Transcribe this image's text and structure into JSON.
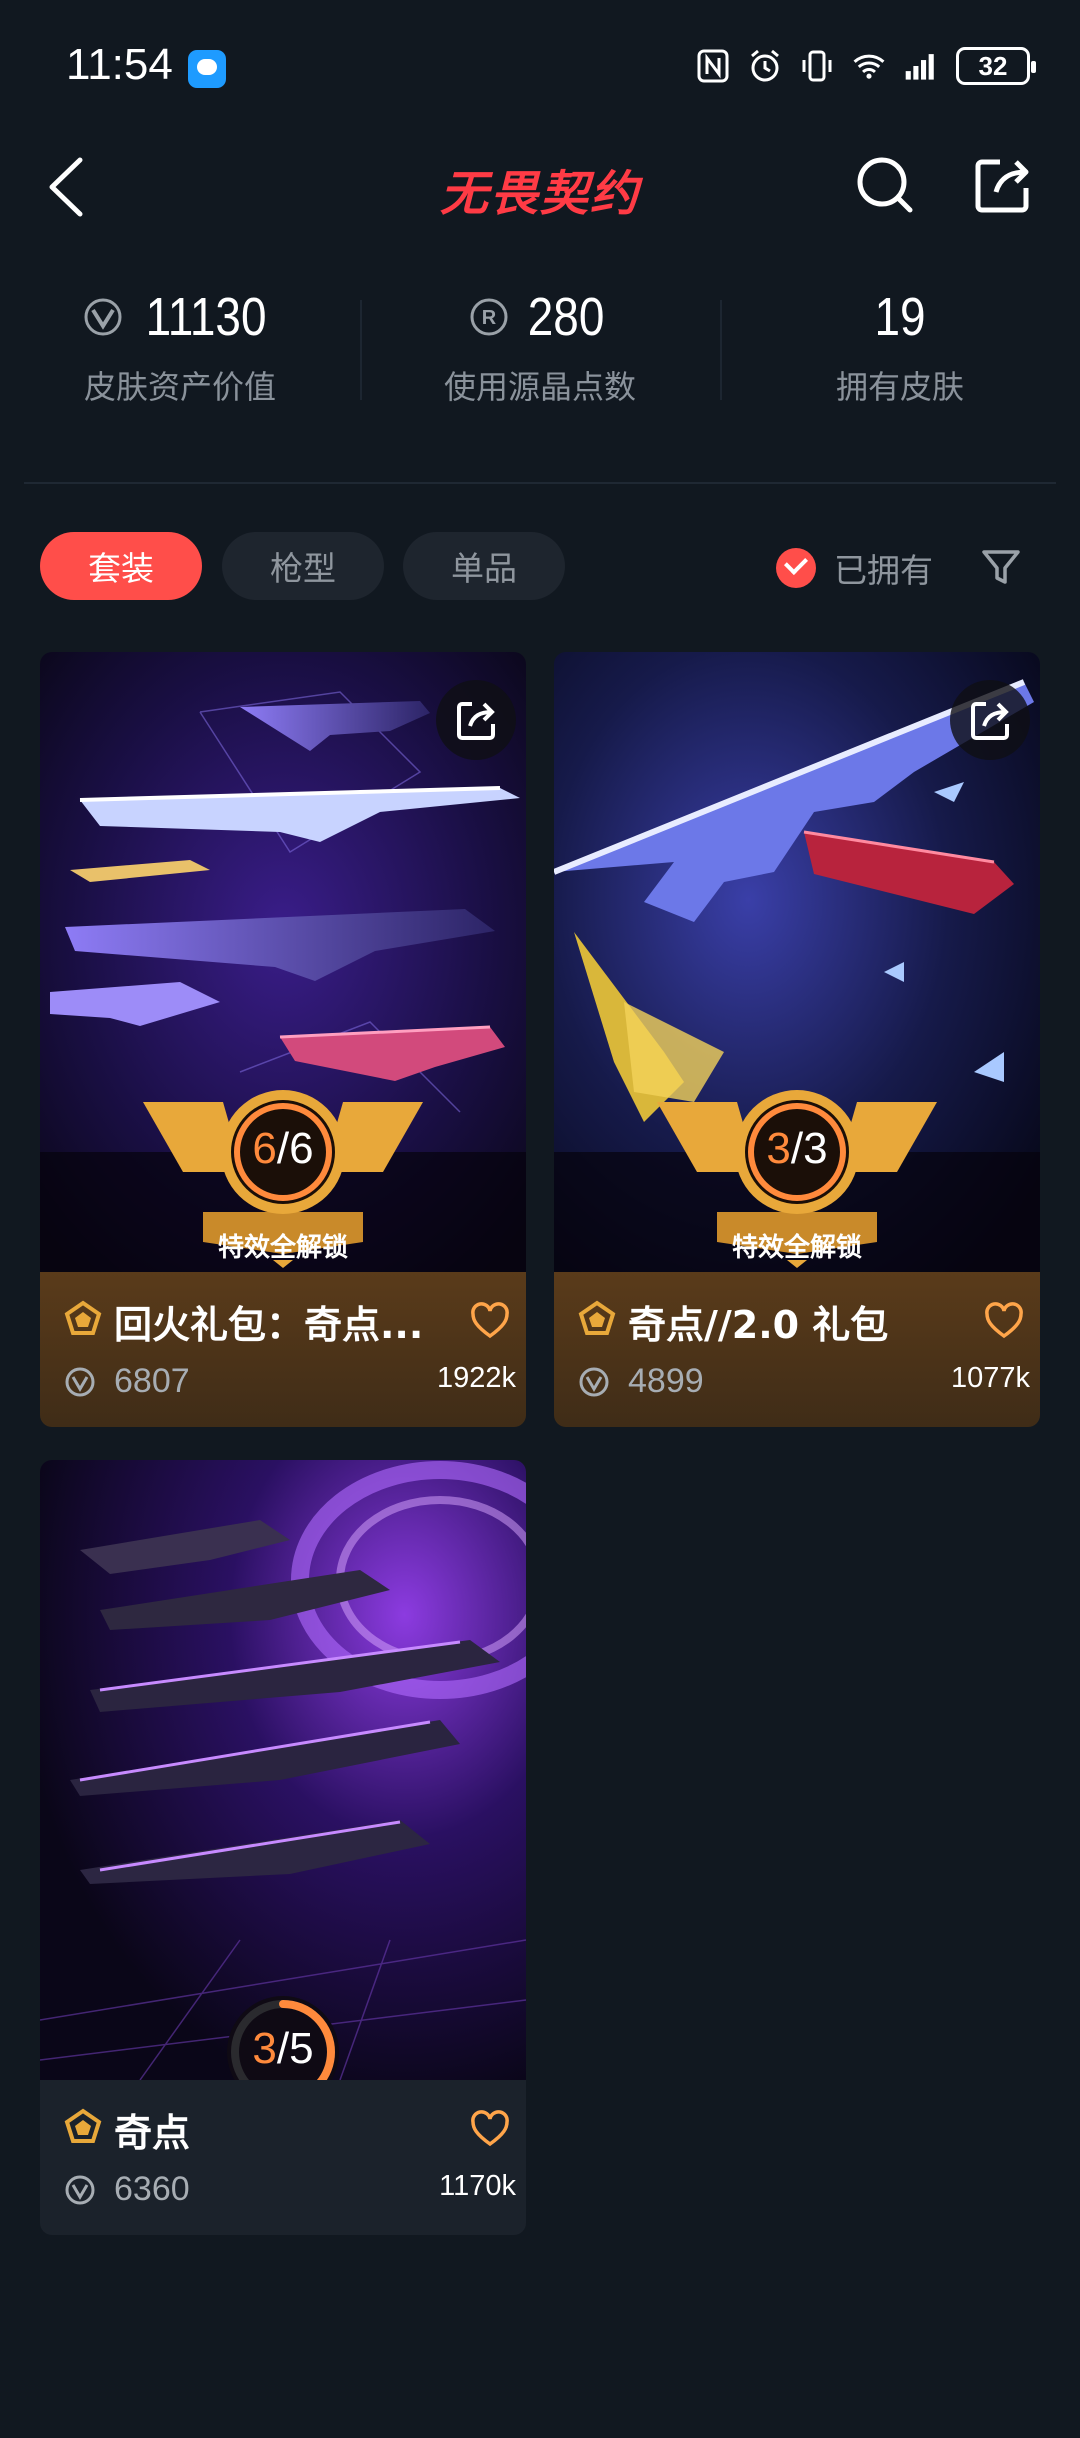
{
  "status_bar": {
    "time": "11:54",
    "battery": "32"
  },
  "header": {
    "logo": "无畏契约"
  },
  "stats": [
    {
      "value": "11130",
      "label": "皮肤资产价值",
      "icon": "valorant-points-icon"
    },
    {
      "value": "280",
      "label": "使用源晶点数",
      "icon": "radianite-icon"
    },
    {
      "value": "19",
      "label": "拥有皮肤"
    }
  ],
  "filter": {
    "tabs": [
      "套装",
      "枪型",
      "单品"
    ],
    "active_tab": "套装",
    "owned_label": "已拥有",
    "owned_checked": true
  },
  "cards": [
    {
      "title": "回火礼包：奇点...",
      "price": "6807",
      "likes": "1922k",
      "owned": "6",
      "total": "6",
      "unlock_label": "特效全解锁"
    },
    {
      "title": "奇点//2.0 礼包",
      "price": "4899",
      "likes": "1077k",
      "owned": "3",
      "total": "3",
      "unlock_label": "特效全解锁"
    },
    {
      "title": "奇点",
      "price": "6360",
      "likes": "1170k",
      "owned": "3",
      "total": "5"
    }
  ],
  "colors": {
    "accent": "#ff4e4a",
    "progress": "#ff8a3c",
    "gold": "#e8a83a"
  }
}
